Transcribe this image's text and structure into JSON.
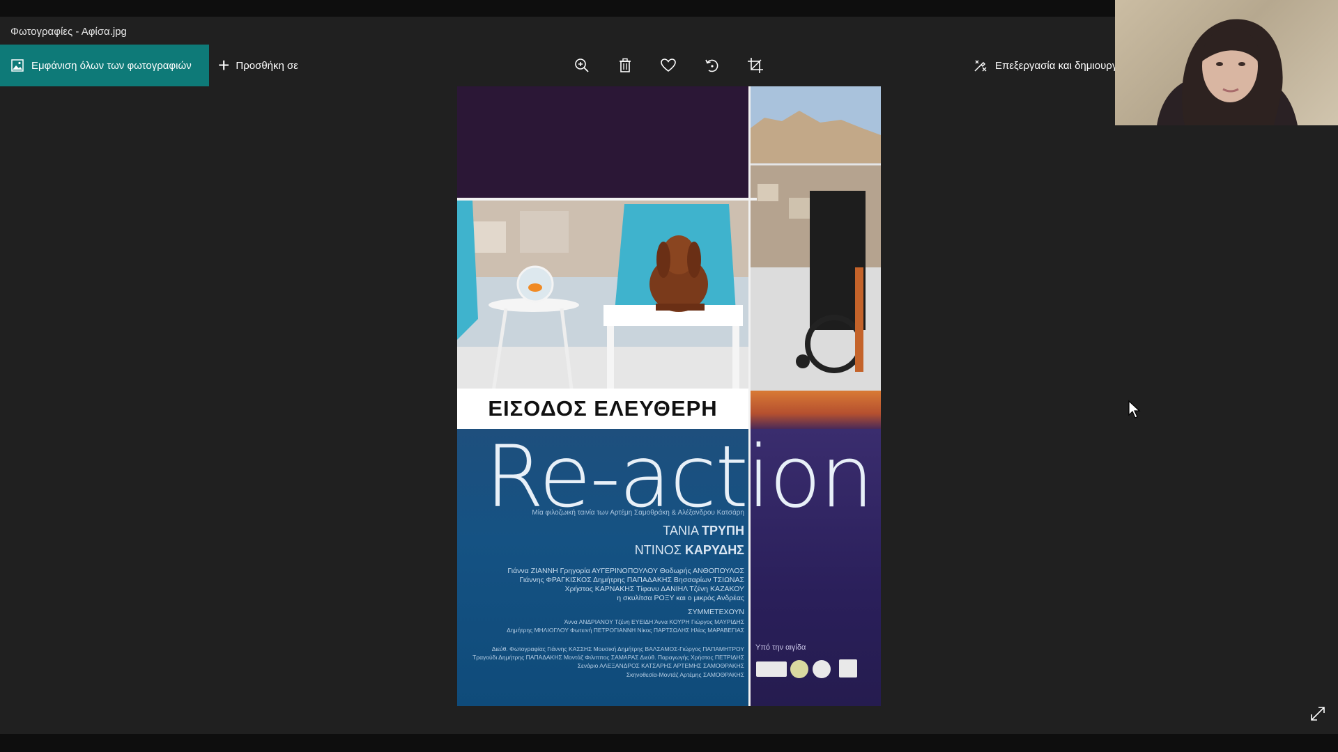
{
  "window": {
    "title": "Φωτογραφίες - Αφίσα.jpg"
  },
  "toolbar": {
    "see_all_label": "Εμφάνιση όλων των φωτογραφιών",
    "add_to_label": "Προσθήκη σε",
    "edit_create_label": "Επεξεργασία και δημιουργ",
    "tools": [
      "zoom-in-icon",
      "delete-icon",
      "favorite-icon",
      "rotate-icon",
      "crop-icon"
    ]
  },
  "poster": {
    "entrance": "ΕΙΣΟΔΟΣ ΕΛΕΥΘΕΡΗ",
    "title": "Re-action",
    "subtitle": "Μία φιλοζωική ταινία των Αρτέμη Σαμοθράκη & Αλέξανδρου Κατσάρη",
    "star1_first": "ΤΑΝΙΑ",
    "star1_last": "ΤΡΥΠΗ",
    "star2_first": "ΝΤΙΝΟΣ",
    "star2_last": "ΚΑΡΥΔΗΣ",
    "cast_line1": "Γιάννα ΖΙΑΝΝΗ   Γρηγορία ΑΥΓΕΡΙΝΟΠΟΥΛΟΥ   Θοδωρής ΑΝΘΟΠΟΥΛΟΣ",
    "cast_line2": "Γιάννης ΦΡΑΓΚΙΣΚΟΣ   Δημήτρης ΠΑΠΑΔΑΚΗΣ   Βησσαρίων ΤΣΙΩΝΑΣ",
    "cast_line3": "Χρήστος ΚΑΡΝΑΚΗΣ   Τίφανυ ΔΑΝΙΗΛ   Τζένη ΚΑΖΑΚΟΥ",
    "cast_line4": "η σκυλίτσα ΡΟΞΥ και ο μικρός Ανδρέας",
    "participate": "ΣΥΜΜΕΤΕΧΟΥΝ",
    "part_line1": "Άννα ΑΝΔΡΙΑΝΟΥ  Τζένη ΕΥΕΙΔΗ  Άννα ΚΟΥΡΗ  Γιώργος ΜΑΥΡΙΔΗΣ",
    "part_line2": "Δημήτρης ΜΗΛΙΟΓΛΟΥ  Φωτεινή ΠΕΤΡΟΓΙΑΝΝΗ  Νίκος ΠΑΡΤΣΩΛΗΣ  Ηλίας ΜΑΡΑΒΕΓΙΑΣ",
    "credit_line1": "Διεύθ. Φωτογραφίας Γιάννης ΚΑΣΣΗΣ  Μουσική Δημήτρης ΒΑΛΣΑΜΟΣ-Γιώργος ΠΑΠΑΜΗΤΡΟΥ",
    "credit_line2": "Τραγούδι Δημήτρης ΠΑΠΑΔΑΚΗΣ  Μοντάζ Φιλιππος ΣΑΜΑΡΑΣ  Διεύθ. Παραγωγής Χρήστος ΠΕΤΡΙΔΗΣ",
    "credit_line3": "Σενάριο ΑΛΕΞΑΝΔΡΟΣ ΚΑΤΣΑΡΗΣ  ΑΡΤΕΜΗΣ ΣΑΜΟΘΡΑΚΗΣ",
    "credit_line4": "Σκηνοθεσία-Μοντάζ Αρτέμης ΣΑΜΟΘΡΑΚΗΣ",
    "aegis": "Υπό την αιγίδα"
  },
  "colors": {
    "accent": "#0e7a78",
    "app_bg": "#202020",
    "poster_blue": "#155283",
    "poster_purple": "#2a1f5a"
  }
}
